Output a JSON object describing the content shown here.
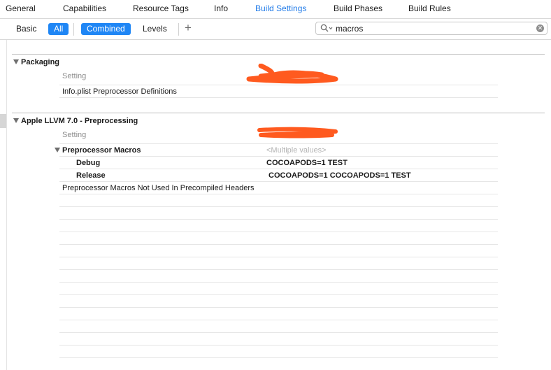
{
  "tabs": [
    {
      "label": "General",
      "active": false
    },
    {
      "label": "Capabilities",
      "active": false
    },
    {
      "label": "Resource Tags",
      "active": false
    },
    {
      "label": "Info",
      "active": false
    },
    {
      "label": "Build Settings",
      "active": true
    },
    {
      "label": "Build Phases",
      "active": false
    },
    {
      "label": "Build Rules",
      "active": false
    }
  ],
  "filter": {
    "basic": "Basic",
    "all": "All",
    "combined": "Combined",
    "levels": "Levels",
    "add": "+"
  },
  "search": {
    "value": "macros",
    "placeholder": ""
  },
  "sections": {
    "packaging": {
      "title": "Packaging",
      "header": "Setting",
      "rows": [
        "Info.plist Preprocessor Definitions"
      ]
    },
    "llvm": {
      "title": "Apple LLVM 7.0 - Preprocessing",
      "header": "Setting",
      "macros_label": "Preprocessor Macros",
      "macros_value": "<Multiple values>",
      "debug_label": "Debug",
      "debug_value": "COCOAPODS=1 TEST",
      "release_label": "Release",
      "release_value": "COCOAPODS=1 COCOAPODS=1 TEST",
      "not_used_label": "Preprocessor Macros Not Used In Precompiled Headers"
    }
  },
  "colors": {
    "accent": "#1f86f5",
    "active_tab": "#1f7ae8",
    "redaction": "#ff5a1f"
  }
}
